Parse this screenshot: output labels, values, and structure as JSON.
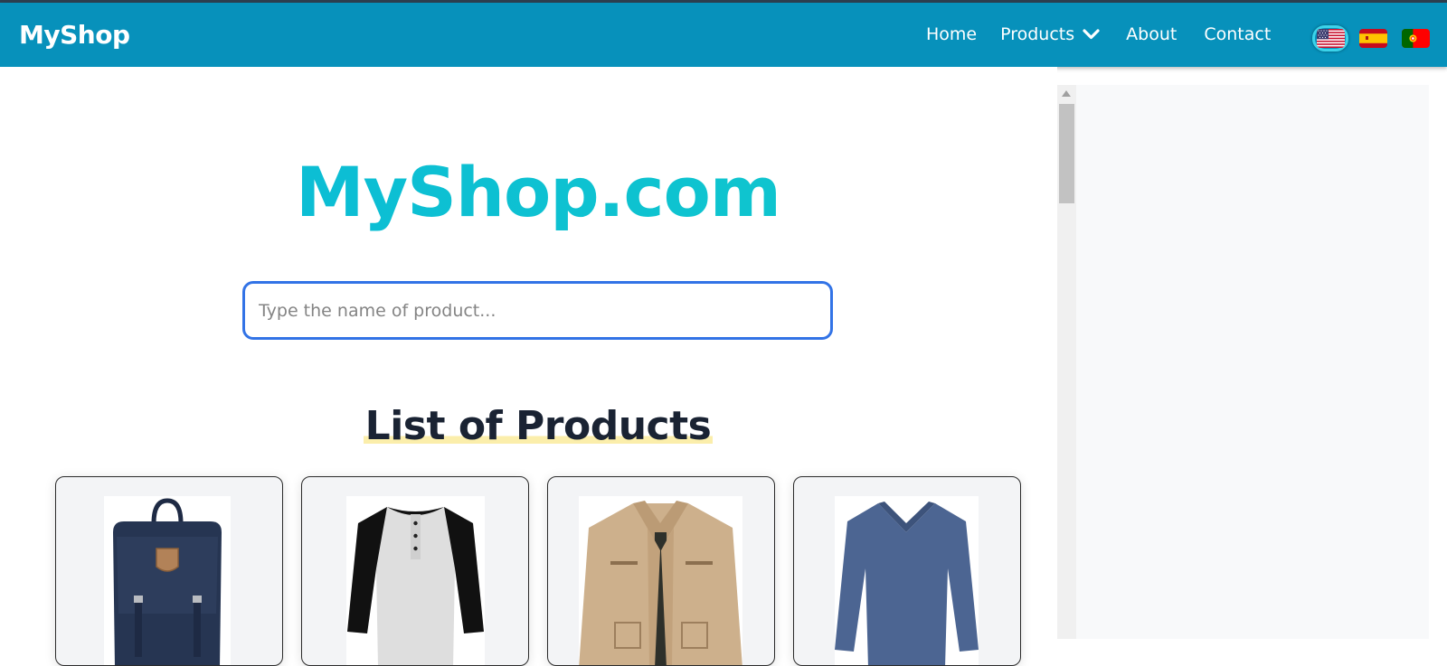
{
  "navbar": {
    "brand": "MyShop",
    "links": [
      {
        "label": "Home"
      },
      {
        "label": "Products",
        "has_dropdown": true
      },
      {
        "label": "About"
      },
      {
        "label": "Contact"
      }
    ],
    "languages": [
      {
        "code": "en",
        "flag": "us-flag-icon",
        "active": true
      },
      {
        "code": "es",
        "flag": "spain-flag-icon",
        "active": false
      },
      {
        "code": "pt",
        "flag": "portugal-flag-icon",
        "active": false
      }
    ]
  },
  "hero": {
    "title": "MyShop.com"
  },
  "search": {
    "placeholder": "Type the name of product...",
    "value": ""
  },
  "products_section": {
    "title": "List of Products",
    "items": [
      {
        "image": "backpack-image"
      },
      {
        "image": "henley-shirt-image"
      },
      {
        "image": "jacket-image"
      },
      {
        "image": "sweater-image"
      }
    ]
  },
  "colors": {
    "navbar": "#0791bb",
    "accent": "#3273e6",
    "hero_gradient_start": "#0ab9d8",
    "hero_gradient_end": "#11c9cb",
    "title_highlight": "#fbeeab"
  }
}
